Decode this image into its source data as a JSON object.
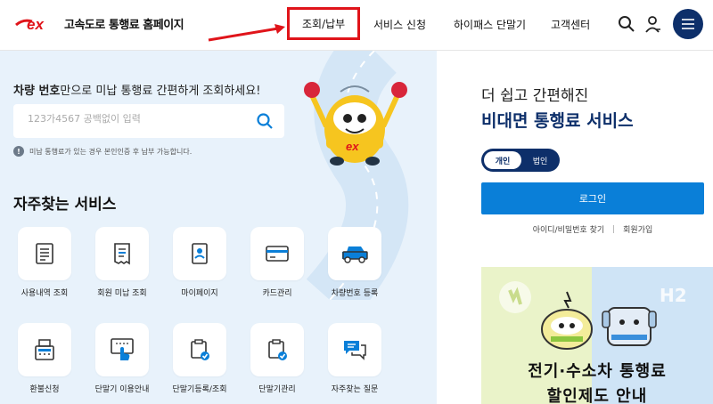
{
  "header": {
    "logo_mark": "ex",
    "logo_text": "고속도로 통행료 홈페이지",
    "nav": [
      {
        "label": "조회/납부",
        "active": true
      },
      {
        "label": "서비스 신청",
        "active": false
      },
      {
        "label": "하이패스 단말기",
        "active": false
      },
      {
        "label": "고객센터",
        "active": false
      }
    ],
    "icons": [
      "search-icon",
      "user-icon",
      "menu-icon"
    ]
  },
  "search": {
    "lead_bold": "차량 번호",
    "lead_rest": "만으로 미납 통행료 간편하게 조회하세요!",
    "placeholder": "123가4567 공백없이 입력",
    "notice": "미납 통행료가 있는 경우 본인인증 후 납부 가능합니다."
  },
  "services": {
    "title": "자주찾는 서비스",
    "items": [
      {
        "label": "사용내역 조회",
        "icon": "document-list-icon"
      },
      {
        "label": "회원 미납 조회",
        "icon": "receipt-icon"
      },
      {
        "label": "마이페이지",
        "icon": "id-card-icon"
      },
      {
        "label": "카드관리",
        "icon": "credit-card-icon"
      },
      {
        "label": "차량번호 등록",
        "icon": "truck-icon"
      },
      {
        "label": "환불신청",
        "icon": "cash-register-icon"
      },
      {
        "label": "단말기 이용안내",
        "icon": "touch-icon"
      },
      {
        "label": "단말기등록/조회",
        "icon": "device-check-icon"
      },
      {
        "label": "단말기관리",
        "icon": "device-check-icon"
      },
      {
        "label": "자주찾는 질문",
        "icon": "chat-icon"
      }
    ]
  },
  "login": {
    "subtitle": "더 쉽고 간편해진",
    "title": "비대면 통행료 서비스",
    "tab_personal": "개인",
    "tab_corporate": "법인",
    "button": "로그인",
    "find_link": "아이디/비밀번호 찾기",
    "join_link": "회원가입"
  },
  "banner": {
    "line1": "전기·수소차 통행료",
    "line2": "할인제도 안내",
    "badge_right": "H2"
  },
  "colors": {
    "brand_red": "#e0141a",
    "navy": "#0d2f6a",
    "primary_blue": "#0a7fd8",
    "panel_bg": "#e8f2fb"
  }
}
